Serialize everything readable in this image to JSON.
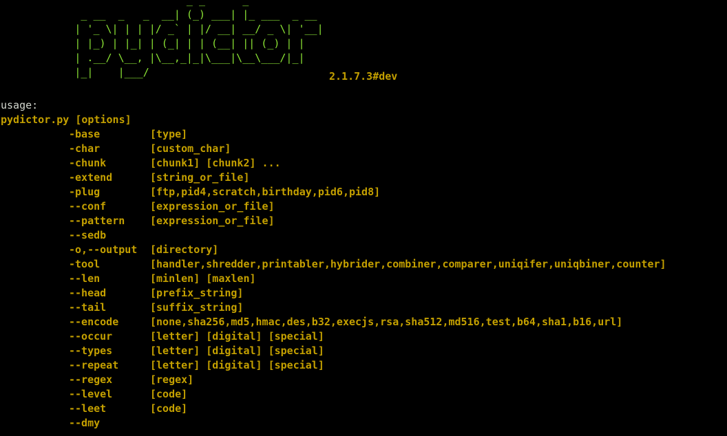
{
  "colors": {
    "background": "#000000",
    "banner": "#8ae234",
    "text": "#d3d7cf",
    "highlight": "#c4a000"
  },
  "banner": {
    "lines": [
      "                              _ _      _",
      "             _ __  _   _  __| (_) ___| |_ ___  _ __",
      "            | '_ \\| | | |/ _` | |/ __| __/ _ \\| '__|",
      "            | |_) | |_| | (_| | | (__| || (_) | |",
      "            | .__/ \\__, |\\__,_|_|\\___|\\__\\___/|_|",
      "            |_|    |___/"
    ]
  },
  "version": "2.1.7.3#dev",
  "usage": {
    "label": "usage:",
    "command": "pydictor.py [options]"
  },
  "options": [
    {
      "name": "-base",
      "args": "[type]"
    },
    {
      "name": "-char",
      "args": "[custom_char]"
    },
    {
      "name": "-chunk",
      "args": "[chunk1] [chunk2] ..."
    },
    {
      "name": "-extend",
      "args": "[string_or_file]"
    },
    {
      "name": "-plug",
      "args": "[ftp,pid4,scratch,birthday,pid6,pid8]"
    },
    {
      "name": "--conf",
      "args": "[expression_or_file]"
    },
    {
      "name": "--pattern",
      "args": "[expression_or_file]"
    },
    {
      "name": "--sedb",
      "args": ""
    },
    {
      "name": "-o,--output",
      "args": "[directory]"
    },
    {
      "name": "-tool",
      "args": "[handler,shredder,printabler,hybrider,combiner,comparer,uniqifer,uniqbiner,counter]"
    },
    {
      "name": "--len",
      "args": "[minlen] [maxlen]"
    },
    {
      "name": "--head",
      "args": "[prefix_string]"
    },
    {
      "name": "--tail",
      "args": "[suffix_string]"
    },
    {
      "name": "--encode",
      "args": "[none,sha256,md5,hmac,des,b32,execjs,rsa,sha512,md516,test,b64,sha1,b16,url]"
    },
    {
      "name": "--occur",
      "args": "[letter] [digital] [special]"
    },
    {
      "name": "--types",
      "args": "[letter] [digital] [special]"
    },
    {
      "name": "--repeat",
      "args": "[letter] [digital] [special]"
    },
    {
      "name": "--regex",
      "args": "[regex]"
    },
    {
      "name": "--level",
      "args": "[code]"
    },
    {
      "name": "--leet",
      "args": "[code]"
    },
    {
      "name": "--dmy",
      "args": ""
    }
  ]
}
